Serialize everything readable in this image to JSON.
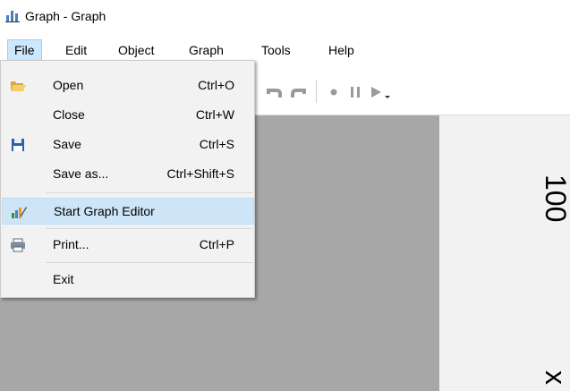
{
  "window": {
    "title": "Graph - Graph"
  },
  "menubar": {
    "items": [
      {
        "label": "File",
        "active": true
      },
      {
        "label": "Edit"
      },
      {
        "label": "Object"
      },
      {
        "label": "Graph"
      },
      {
        "label": "Tools"
      },
      {
        "label": "Help"
      }
    ]
  },
  "file_menu": {
    "items": [
      {
        "label": "Open",
        "shortcut": "Ctrl+O",
        "icon": "folder-open-icon"
      },
      {
        "label": "Close",
        "shortcut": "Ctrl+W"
      },
      {
        "label": "Save",
        "shortcut": "Ctrl+S",
        "icon": "floppy-disk-icon"
      },
      {
        "label": "Save as...",
        "shortcut": "Ctrl+Shift+S"
      },
      {
        "label": "Start Graph Editor",
        "icon": "graph-editor-icon",
        "highlighted": true
      },
      {
        "label": "Print...",
        "shortcut": "Ctrl+P",
        "icon": "printer-icon"
      },
      {
        "label": "Exit"
      }
    ]
  },
  "toolbar": {
    "icons": [
      "undo-icon",
      "redo-icon",
      "record-icon",
      "pause-icon",
      "play-dropdown-icon"
    ]
  },
  "canvas": {
    "axis_text_1": "100",
    "axis_text_2": "x"
  },
  "colors": {
    "menu_highlight": "#cde5f7",
    "menubar_active": "#cce8ff",
    "canvas_gray": "#a7a7a7"
  }
}
